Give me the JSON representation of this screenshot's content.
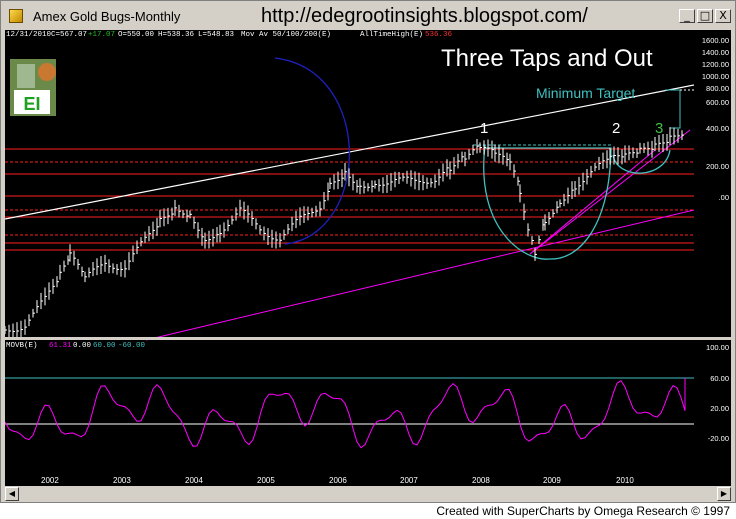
{
  "window": {
    "title": "Amex Gold Bugs-Monthly",
    "url_overlay": "http://edegrootinsights.blogspot.com/",
    "buttons": [
      "_",
      "□",
      "X"
    ]
  },
  "header": {
    "date": "12/31/2010",
    "change": "+17.07",
    "ohlc": [
      "C=567.07",
      "O=550.00",
      "H=538.36",
      "L=548.83"
    ],
    "ma_label": "Mov Av 50/100/200(E)",
    "ath_label": "AllTimeHigh(E)",
    "ath_value": "536.36"
  },
  "annotations": {
    "headline": "Three Taps and Out",
    "minimum_target": "Minimum Target",
    "tap1": "1",
    "tap2": "2",
    "tap3": "3",
    "logo": "EI"
  },
  "price_axis": [
    "1600.00",
    "1400.00",
    "1200.00",
    "1000.00",
    "800.00",
    "600.00",
    "400.00",
    "200.00",
    ".00"
  ],
  "indicator": {
    "label": "MOVB(E)",
    "value": "61.31",
    "zero": "0.00",
    "upper": "60.00",
    "lower": "-60.00",
    "axis": [
      "100.00",
      "60.00",
      "20.00",
      "-20.00"
    ]
  },
  "x_axis": [
    "2002",
    "2003",
    "2004",
    "2005",
    "2006",
    "2007",
    "2008",
    "2009",
    "2010"
  ],
  "footer": "Created with SuperCharts by Omega Research © 1997",
  "colors": {
    "background": "#000000",
    "bars": "#ffffff",
    "resistance": "#ff2020",
    "trendline_upper": "#ffffff",
    "trendline_lower": "#ff00ff",
    "cup": "#40c0c0",
    "arc": "#2020c0",
    "oscillator": "#ff00ff",
    "headline": "#ffffff",
    "target": "#40c0c0",
    "tap3": "#40c040"
  }
}
